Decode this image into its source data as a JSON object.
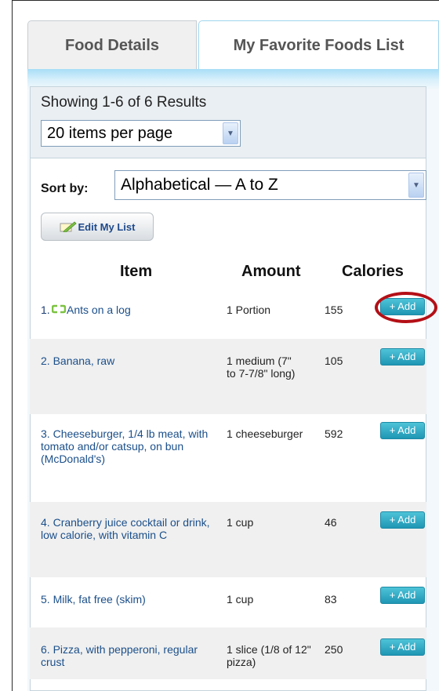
{
  "tabs": [
    {
      "label": "Food Details",
      "active": false
    },
    {
      "label": "My Favorite Foods List",
      "active": true
    }
  ],
  "results": {
    "showing": "Showing 1-6 of 6 Results",
    "per_page": "20 items per page"
  },
  "sort": {
    "label": "Sort by:",
    "value": "Alphabetical — A to Z"
  },
  "edit_button": "Edit My List",
  "columns": {
    "item": "Item",
    "amount": "Amount",
    "calories": "Calories"
  },
  "add_label": "+ Add",
  "rows": [
    {
      "num": "1.",
      "name": "Ants on a log",
      "amount": "1 Portion",
      "calories": "155",
      "icon": "recycle-icon"
    },
    {
      "num": "2.",
      "name": "Banana, raw",
      "amount": "1 medium (7\" to 7-7/8\" long)",
      "calories": "105"
    },
    {
      "num": "3.",
      "name": "Cheeseburger, 1/4 lb meat, with tomato and/or catsup, on bun (McDonald's)",
      "amount": "1 cheeseburger",
      "calories": "592"
    },
    {
      "num": "4.",
      "name": "Cranberry juice cocktail or drink, low calorie, with vitamin C",
      "amount": "1 cup",
      "calories": "46"
    },
    {
      "num": "5.",
      "name": "Milk, fat free (skim)",
      "amount": "1 cup",
      "calories": "83"
    },
    {
      "num": "6.",
      "name": "Pizza, with pepperoni, regular crust",
      "amount": "1 slice (1/8 of 12\" pizza)",
      "calories": "250"
    }
  ],
  "colors": {
    "accent": "#2aa7c4",
    "link": "#1b4f8a",
    "highlight": "#b40f16",
    "icon": "#7cc242"
  }
}
